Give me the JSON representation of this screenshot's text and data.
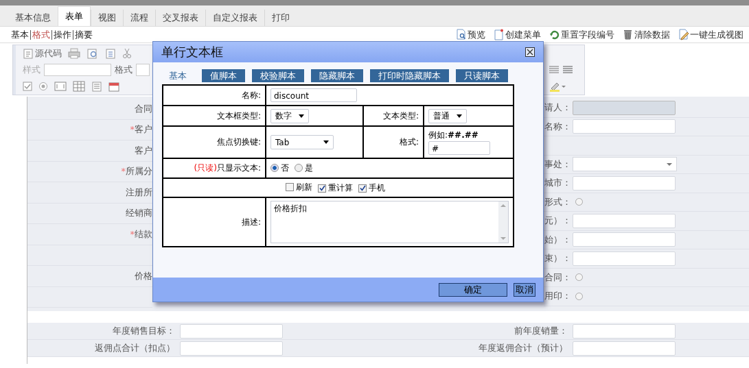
{
  "top_tabs": [
    {
      "label": "基本信息",
      "selected": false
    },
    {
      "label": "表单",
      "selected": true
    },
    {
      "label": "视图",
      "selected": false
    },
    {
      "label": "流程",
      "selected": false
    },
    {
      "label": "交叉报表",
      "selected": false
    },
    {
      "label": "自定义报表",
      "selected": false
    },
    {
      "label": "打印",
      "selected": false
    }
  ],
  "sub_tabs": [
    {
      "label": "基本",
      "selected": false
    },
    {
      "label": "格式",
      "selected": true
    },
    {
      "label": "操作",
      "selected": false
    },
    {
      "label": "摘要",
      "selected": false
    }
  ],
  "actions": [
    {
      "label": "预览",
      "kind": "preview"
    },
    {
      "label": "创建菜单",
      "kind": "menu"
    },
    {
      "label": "重置字段编号",
      "kind": "reset"
    },
    {
      "label": "清除数据",
      "kind": "clear"
    },
    {
      "label": "一键生成视图",
      "kind": "view"
    }
  ],
  "editor_toolbar": {
    "source_label": "源代码",
    "style_label": "样式",
    "format_label": "格式"
  },
  "form": {
    "left_rows": [
      {
        "kind": "label",
        "label": "合同"
      },
      {
        "kind": "label",
        "prefix": "*",
        "label": "客户"
      },
      {
        "kind": "label",
        "label": "客户"
      },
      {
        "kind": "label",
        "prefix": "*",
        "label": "所属分"
      },
      {
        "kind": "label",
        "label": "注册所"
      },
      {
        "kind": "label",
        "label": "经销商"
      },
      {
        "kind": "label",
        "prefix": "*",
        "label": "结款"
      },
      {
        "kind": "empty"
      },
      {
        "kind": "label",
        "label": "价格"
      },
      {
        "kind": "empty"
      }
    ],
    "right_rows": [
      {
        "label": "请人：",
        "kind": "readonly"
      },
      {
        "label": "名称：",
        "kind": "text"
      },
      {
        "kind": "none"
      },
      {
        "label": "事处：",
        "kind": "select"
      },
      {
        "label": "城市：",
        "kind": "text"
      },
      {
        "label": "形式：",
        "kind": "radio",
        "selected": false
      },
      {
        "label": "元）：",
        "kind": "text"
      },
      {
        "label": "始）：",
        "kind": "text"
      },
      {
        "label": "束）：",
        "kind": "text"
      },
      {
        "label": "合同：",
        "kind": "radio",
        "selected": false
      },
      {
        "label": "用印：",
        "kind": "radio",
        "selected": false
      }
    ],
    "bottom_rows": [
      {
        "label_1": "年度销售目标：",
        "label_2": "前年度销量："
      },
      {
        "label_1": "返佣点合计（扣点）",
        "label_2": "年度返佣合计（预计）"
      }
    ]
  },
  "dialog": {
    "title": "单行文本框",
    "tabs": [
      {
        "label": "基本",
        "selected": true
      },
      {
        "label": "值脚本",
        "selected": false
      },
      {
        "label": "校验脚本",
        "selected": false
      },
      {
        "label": "隐藏脚本",
        "selected": false
      },
      {
        "label": "打印时隐藏脚本",
        "selected": false
      },
      {
        "label": "只读脚本",
        "selected": false
      }
    ],
    "name_label": "名称:",
    "name_value": "discount",
    "box_type_label": "文本框类型:",
    "box_type_value": "数字",
    "text_type_label": "文本类型:",
    "text_type_value": "普通",
    "focus_key_label": "焦点切换键:",
    "focus_key_value": "Tab",
    "format_label": "格式:",
    "format_hint": "例如:**##.##**",
    "format_value": "#",
    "readonly_prefix": "(只读)",
    "readonly_label": "只显示文本:",
    "options": [
      {
        "label": "否",
        "selected": true
      },
      {
        "label": "是",
        "selected": false
      }
    ],
    "checks": [
      {
        "label": "刷新",
        "checked": false
      },
      {
        "label": "重计算",
        "checked": true
      },
      {
        "label": "手机",
        "checked": true
      }
    ],
    "description_label": "描述:",
    "description_value": "价格折扣",
    "buttons": [
      "确定",
      "取消"
    ]
  }
}
